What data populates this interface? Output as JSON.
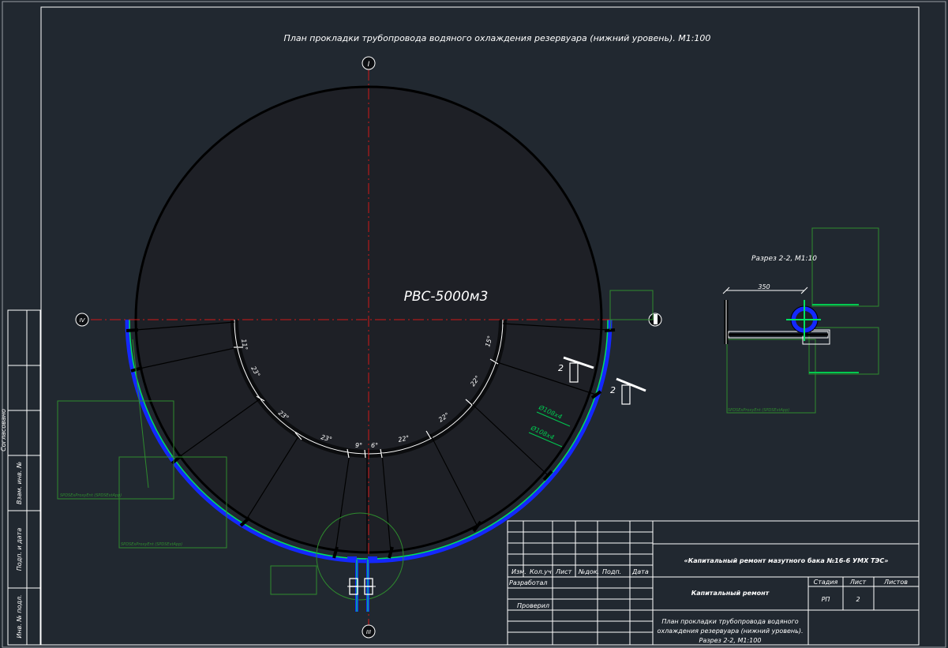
{
  "drawing": {
    "title": "План прокладки трубопровода водяного охлаждения резервуара (нижний уровень). М1:100",
    "tank_label": "РВС-5000м3",
    "axis_labels": {
      "top": "I",
      "left": "IV",
      "bottom": "III"
    },
    "angles": [
      "11°",
      "23°",
      "23°",
      "23°",
      "9°",
      "6°",
      "22°",
      "22°",
      "22°",
      "15°"
    ],
    "pipe_labels": [
      "Ø108х4",
      "Ø108х4"
    ],
    "section_marks": [
      "2",
      "2"
    ],
    "proxy_labels": [
      "SPDSExProxyEnt (SPDSExtApp)",
      "SPDSExProxyEnt (SPDSExtApp)",
      "SPDSExProxyEnt (SPDSExtApp)"
    ]
  },
  "section": {
    "title": "Разрез 2-2, М1:10",
    "dimension": "350"
  },
  "side_stamp": [
    "Согласовано",
    "Взам. инв. №",
    "Подп. и дата",
    "Инв. № подл."
  ],
  "title_block": {
    "project": "«Капитальный ремонт мазутного бака №16-6 УМХ ТЭС»",
    "work_type": "Капитальный ремонт",
    "sheet_title_lines": [
      "План прокладки трубопровода водяного",
      "охлаждения резервуара (нижний уровень).",
      "Разрез 2-2, М1:100"
    ],
    "headers": [
      "Изм.",
      "Кол.уч",
      "Лист",
      "№док.",
      "Подп.",
      "Дата"
    ],
    "roles": [
      "Разработал",
      "Проверил"
    ],
    "stage_headers": [
      "Стадия",
      "Лист",
      "Листов"
    ],
    "stage_values": [
      "РП",
      "2",
      ""
    ]
  },
  "colors": {
    "background": "#212830",
    "frame": "#ffffff",
    "tank": "#000000",
    "axis": "#d01818",
    "pipe": "#1428ff",
    "pipe_inner": "#00e060",
    "annotation": "#2e8b2e"
  }
}
